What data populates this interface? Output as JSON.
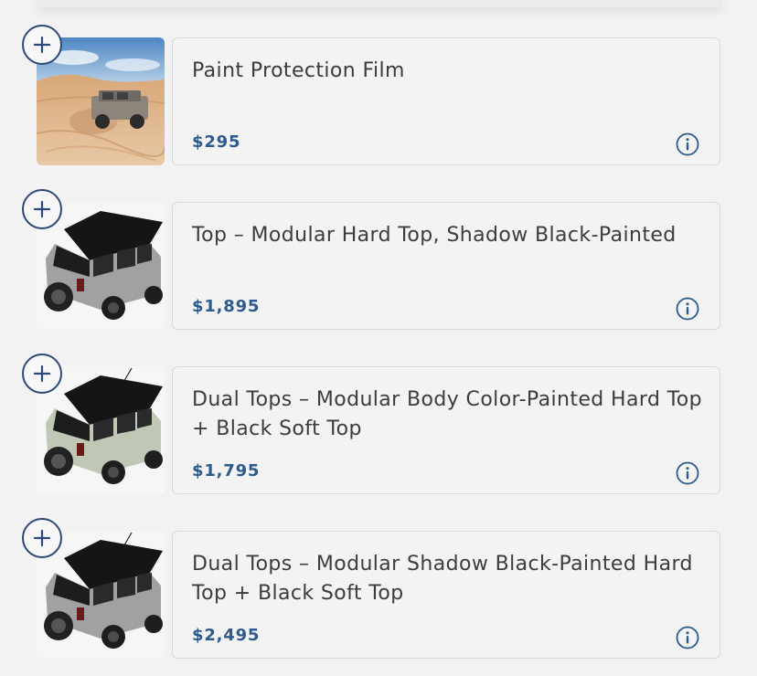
{
  "items": [
    {
      "title": "Paint Protection Film",
      "price": "$295",
      "image": "desert-bronco-photo"
    },
    {
      "title": "Top – Modular Hard Top, Shadow Black-Painted",
      "price": "$1,895",
      "image": "bronco-gray-hardtop-photo"
    },
    {
      "title": "Dual Tops – Modular Body Color-Painted Hard Top + Black Soft Top",
      "price": "$1,795",
      "image": "bronco-sage-dualtop-photo"
    },
    {
      "title": "Dual Tops – Modular Shadow Black-Painted Hard Top + Black Soft Top",
      "price": "$2,495",
      "image": "bronco-gray-dualtop-photo"
    }
  ],
  "colors": {
    "accent": "#2b4a78",
    "price": "#2c5a8f",
    "text": "#3c3c3c",
    "border": "#d8d8d8",
    "background": "#f2f2f2"
  },
  "icons": {
    "add": "plus-icon",
    "info": "info-icon"
  }
}
